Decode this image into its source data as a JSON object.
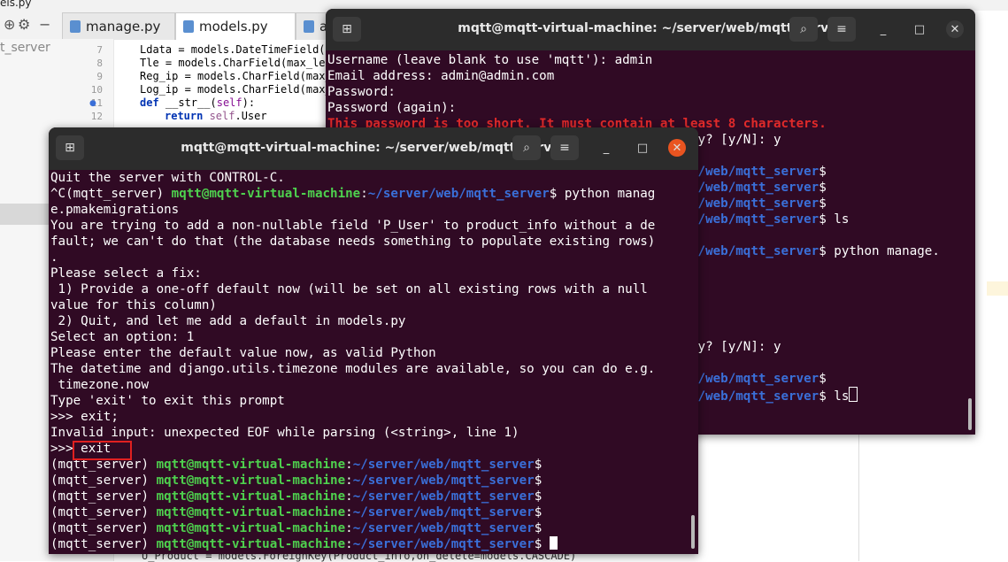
{
  "ide": {
    "topbar_text": "els.py",
    "project_label": "t_server",
    "tabs": [
      {
        "label": "manage.py"
      },
      {
        "label": "models.py"
      },
      {
        "label": "app"
      }
    ],
    "lines": [
      {
        "num": "7",
        "code": "Ldata = models.DateTimeField()"
      },
      {
        "num": "8",
        "code": "Tle = models.CharField(max_len"
      },
      {
        "num": "9",
        "code": "Reg_ip = models.CharField(max_"
      },
      {
        "num": "10",
        "code": "Log_ip = models.CharField(max_"
      },
      {
        "num": "11",
        "kw": "def",
        "fn": " __str__(",
        "param": "self",
        "end": "):"
      },
      {
        "num": "12",
        "kw": "return",
        "self": " self",
        "end": ".User"
      }
    ],
    "bottom_line": "U_Product = models.ForeignKey(Product_info,on_delete=models.CASCADE)"
  },
  "back_terminal": {
    "title": "mqtt@mqtt-virtual-machine: ~/server/web/mqtt_server",
    "lines": [
      {
        "t": "Username (leave blank to use 'mqtt'): admin"
      },
      {
        "t": "Email address: admin@admin.com"
      },
      {
        "t": "Password:"
      },
      {
        "t": "Password (again):"
      },
      {
        "red": "This password is too short. It must contain at least 8 characters."
      },
      {
        "t": "                                                ay? [y/N]: y"
      },
      {
        "t": ""
      },
      {
        "blue": "                                                r/web/mqtt_server",
        "t": "$"
      },
      {
        "blue": "                                                r/web/mqtt_server",
        "t": "$"
      },
      {
        "blue": "                                                r/web/mqtt_server",
        "t": "$"
      },
      {
        "blue": "                                                r/web/mqtt_server",
        "t": "$ ls"
      },
      {
        "t": ""
      },
      {
        "blue": "                                                r/web/mqtt_server",
        "t": "$ python manage."
      },
      {
        "t": ""
      },
      {
        "t": ""
      },
      {
        "t": ""
      },
      {
        "t": ""
      },
      {
        "t": ""
      },
      {
        "t": "                                                ay? [y/N]: y"
      },
      {
        "t": ""
      },
      {
        "blue": "                                                r/web/mqtt_server",
        "t": "$"
      },
      {
        "blue": "                                                r/web/mqtt_server",
        "t": "$ ls"
      }
    ]
  },
  "front_terminal": {
    "title": "mqtt@mqtt-virtual-machine: ~/server/web/mqtt_server",
    "lines": [
      {
        "t": "Quit the server with CONTROL-C."
      },
      {
        "pre": "^C(mqtt_server) ",
        "green": "mqtt@mqtt-virtual-machine",
        "sep": ":",
        "blue": "~/server/web/mqtt_server",
        "t": "$ python manag"
      },
      {
        "t": "e.pmakemigrations"
      },
      {
        "t": "You are trying to add a non-nullable field 'P_User' to product_info without a de"
      },
      {
        "t": "fault; we can't do that (the database needs something to populate existing rows)"
      },
      {
        "t": "."
      },
      {
        "t": "Please select a fix:"
      },
      {
        "t": " 1) Provide a one-off default now (will be set on all existing rows with a null"
      },
      {
        "t": "value for this column)"
      },
      {
        "t": " 2) Quit, and let me add a default in models.py"
      },
      {
        "t": "Select an option: 1"
      },
      {
        "t": "Please enter the default value now, as valid Python"
      },
      {
        "t": "The datetime and django.utils.timezone modules are available, so you can do e.g."
      },
      {
        "t": " timezone.now"
      },
      {
        "t": "Type 'exit' to exit this prompt"
      },
      {
        "t": ">>> exit;"
      },
      {
        "t": "Invalid input: unexpected EOF while parsing (<string>, line 1)"
      },
      {
        "t": ">>> exit"
      },
      {
        "pre": "(mqtt_server) ",
        "green": "mqtt@mqtt-virtual-machine",
        "sep": ":",
        "blue": "~/server/web/mqtt_server",
        "t": "$"
      },
      {
        "pre": "(mqtt_server) ",
        "green": "mqtt@mqtt-virtual-machine",
        "sep": ":",
        "blue": "~/server/web/mqtt_server",
        "t": "$"
      },
      {
        "pre": "(mqtt_server) ",
        "green": "mqtt@mqtt-virtual-machine",
        "sep": ":",
        "blue": "~/server/web/mqtt_server",
        "t": "$"
      },
      {
        "pre": "(mqtt_server) ",
        "green": "mqtt@mqtt-virtual-machine",
        "sep": ":",
        "blue": "~/server/web/mqtt_server",
        "t": "$"
      },
      {
        "pre": "(mqtt_server) ",
        "green": "mqtt@mqtt-virtual-machine",
        "sep": ":",
        "blue": "~/server/web/mqtt_server",
        "t": "$"
      },
      {
        "pre": "(mqtt_server) ",
        "green": "mqtt@mqtt-virtual-machine",
        "sep": ":",
        "blue": "~/server/web/mqtt_server",
        "t": "$ "
      }
    ]
  },
  "colors": {
    "terminal_bg": "#300a24",
    "header_bg": "#2c2c2c",
    "prompt_user": "#4ed14e",
    "prompt_path": "#3a6fd8",
    "error": "#e02a2a",
    "close_button": "#e95420",
    "annotation": "#e02020"
  },
  "icons": {
    "new_tab": "new-tab-icon",
    "search": "search-icon",
    "menu": "hamburger-menu-icon",
    "minimize": "minimize-icon",
    "maximize": "maximize-icon",
    "close": "close-icon"
  }
}
